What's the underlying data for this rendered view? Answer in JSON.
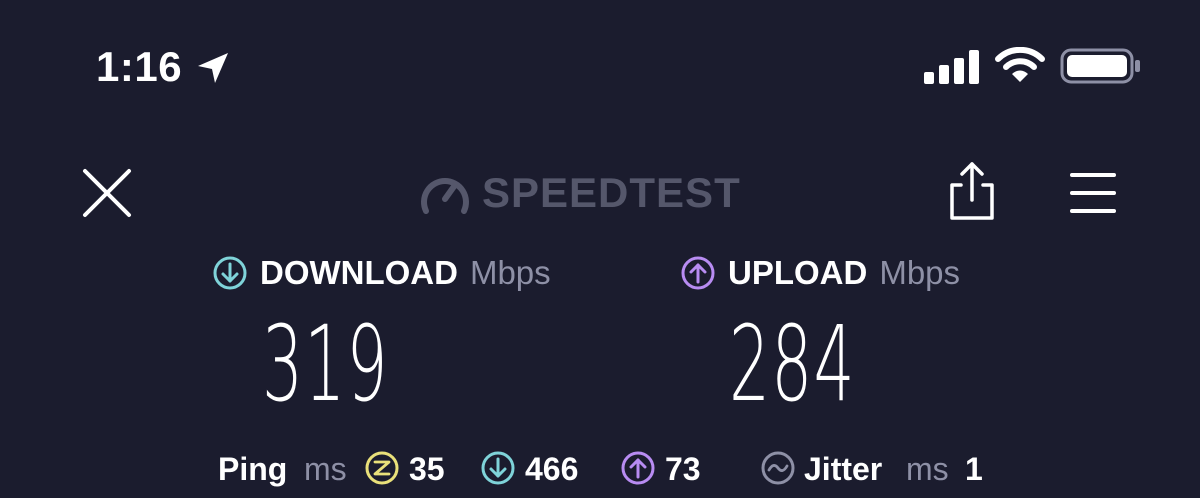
{
  "status_bar": {
    "time": "1:16",
    "icons": [
      "location-arrow-icon",
      "signal-bars-icon",
      "wifi-icon",
      "battery-icon"
    ]
  },
  "header": {
    "brand": "SPEEDTEST",
    "icons": [
      "close-icon",
      "speedometer-icon",
      "share-icon",
      "menu-icon"
    ]
  },
  "download": {
    "label": "DOWNLOAD",
    "unit": "Mbps",
    "value": "319",
    "color": "#7fd3d9"
  },
  "upload": {
    "label": "UPLOAD",
    "unit": "Mbps",
    "value": "284",
    "color": "#b88cf2"
  },
  "stats": {
    "ping_label": "Ping",
    "ping_unit": "ms",
    "ping_idle": "35",
    "ping_idle_color": "#e9e07a",
    "ping_download": "466",
    "ping_upload": "73",
    "jitter_label": "Jitter",
    "jitter_unit": "ms",
    "jitter": "1",
    "jitter_color": "#8e90a6"
  },
  "colors": {
    "background": "#1b1c2e",
    "muted": "#8e90a6",
    "brand": "#55576b"
  }
}
